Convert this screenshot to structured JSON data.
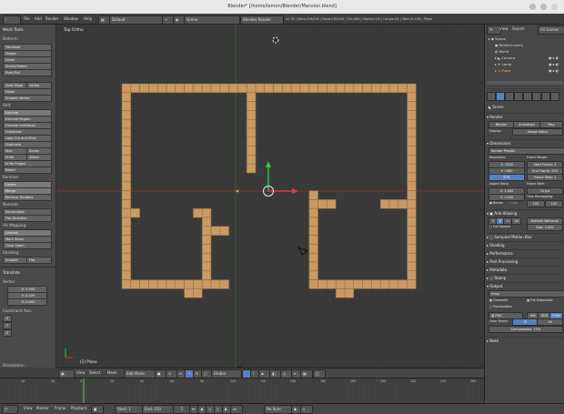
{
  "window": {
    "title": "Blender* [/home/lemon/Blender/Mansion.blend]"
  },
  "info_bar": {
    "menus": [
      "File",
      "Add",
      "Render",
      "Window",
      "Help"
    ],
    "screen_layout": "Default",
    "scene": "Scene",
    "render_engine": "Blender Render",
    "stats": "v2.78 | Verts:216/216 | Faces:192/192 | Tris:384 | Objects:1/3 | Lamps:0/1 | Mem:9.11M | Plane"
  },
  "toolshelf": {
    "headers": [
      "Mesh Tools",
      "Deform:",
      "Add:",
      "Remove:",
      "UV Mapping:",
      "Shading:",
      "Translate",
      "Vector",
      "Constraint Axis",
      "Orientation"
    ],
    "buttons": [
      "Translate",
      "Rotate",
      "Scale",
      "Shrink/Fatten",
      "Push/Pull",
      "Slide Edge",
      "Vertex",
      "Noise",
      "Smooth Vertex",
      "Extrude",
      "Extrude Region",
      "Extrude Individual",
      "Subdivide",
      "Loop Cut and Slide",
      "Duplicate",
      "Spin",
      "Screw",
      "Knife",
      "Select",
      "Knife Project",
      "Bisect",
      "Delete",
      "Merge",
      "Remove Doubles",
      "Unwrap",
      "Mark Seam",
      "Clear Seam",
      "Smooth",
      "Flat"
    ],
    "operator": {
      "vector_x": "X: 0.000",
      "vector_y": "Y: 0.109",
      "vector_z": "Z: 0.000",
      "axes": [
        "X",
        "Y",
        "Z"
      ]
    },
    "header_labels": [
      "Normals",
      "Recalculate",
      "Flip Direction"
    ]
  },
  "viewport": {
    "label": "Top Ortho",
    "object_label": "(1) Plane"
  },
  "viewport_header": {
    "menus": [
      "View",
      "Select",
      "Mesh"
    ],
    "mode": "Edit Mode",
    "orientation": "Global"
  },
  "timeline": {
    "ticks": [
      "-40",
      "-20",
      "0",
      "20",
      "40",
      "60",
      "80",
      "100",
      "120",
      "140",
      "160",
      "180",
      "200",
      "220",
      "240",
      "260"
    ],
    "menus": [
      "View",
      "Marker",
      "Frame",
      "Playback"
    ],
    "start": "Start: 1",
    "end": "End: 250",
    "current": "1",
    "sync": "No Sync"
  },
  "outliner": {
    "menus": [
      "View",
      "Search",
      "All Scenes"
    ],
    "items": [
      "Scene",
      "RenderLayers",
      "World",
      "Camera",
      "Lamp",
      "Plane"
    ]
  },
  "properties": {
    "object_name": "Scene",
    "sections": [
      "Render",
      "Dimensions",
      "Anti-Aliasing",
      "Sampled Motion Blur",
      "Shading",
      "Performance",
      "Post Processing",
      "Metadata",
      "Stamp",
      "Output",
      "Bake"
    ],
    "render_buttons": [
      "Render",
      "Animation",
      "Play"
    ],
    "display_label": "Display",
    "display_value": "Image Editor",
    "render_presets": "Render Presets",
    "resolution_label": "Resolution:",
    "res_x": "X: 1920",
    "res_y": "Y: 1080",
    "res_pct": "50%",
    "frame_range_label": "Frame Range:",
    "start_frame": "Start Frame: 1",
    "end_frame": "End Frame: 250",
    "frame_step": "Frame Step: 1",
    "aspect_label": "Aspect Ratio:",
    "aspect_x": "X: 1.000",
    "aspect_y": "Y: 1.000",
    "frame_rate_label": "Frame Rate:",
    "frame_rate": "24 fps",
    "time_remap": "Time Remapping:",
    "old": "100",
    "new": "100",
    "border": "Border",
    "crop": "Crop",
    "aa_samples": [
      "5",
      "8",
      "11",
      "16"
    ],
    "aa_filter": "Mitchell-Netravali",
    "full_sample": "Full Sample",
    "size": "Size: 1.000",
    "output_path": "/tmp/",
    "overwrite": "Overwrite",
    "file_extensions": "File Extensions",
    "placeholders": "Placeholders",
    "format": "PNG",
    "color_modes": [
      "BW",
      "RGB",
      "RGBA"
    ],
    "color_depth_label": "Color Depth:",
    "color_depth": [
      "8",
      "16"
    ],
    "compression": "Compression: 15%"
  },
  "colors": {
    "floorplan": "#c99a63",
    "floorplan_edge": "#8a6a40",
    "x_axis": "#a33838",
    "y_axis": "#3c8c3c",
    "accent": "#5680c2"
  }
}
